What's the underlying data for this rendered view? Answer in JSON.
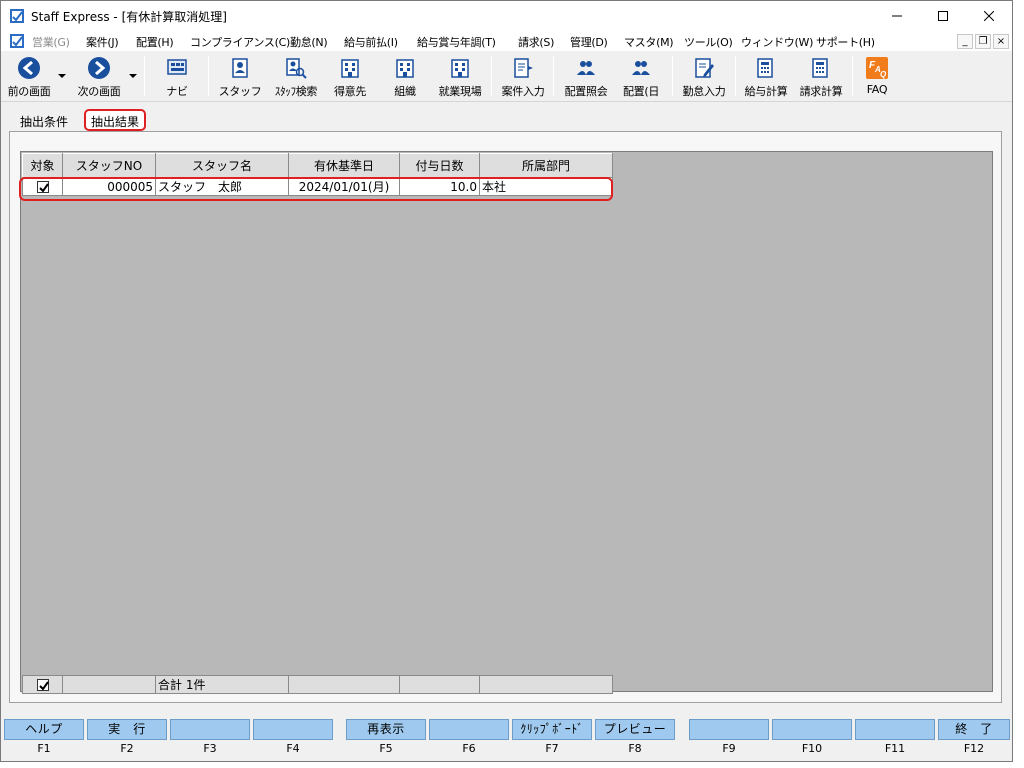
{
  "window": {
    "title": "Staff Express - [有休計算取消処理]"
  },
  "menubar": {
    "items": [
      {
        "label": "営業(G)",
        "disabled": true
      },
      {
        "label": "案件(J)"
      },
      {
        "label": "配置(H)"
      },
      {
        "label": "コンプライアンス(C)"
      },
      {
        "label": "勤怠(N)"
      },
      {
        "label": "給与前払(I)"
      },
      {
        "label": "給与賞与年調(T)"
      },
      {
        "label": "請求(S)"
      },
      {
        "label": "管理(D)"
      },
      {
        "label": "マスタ(M)"
      },
      {
        "label": "ツール(O)"
      },
      {
        "label": "ウィンドウ(W)"
      },
      {
        "label": "サポート(H)"
      }
    ],
    "mdi_minimize": "_",
    "mdi_restore": "❐",
    "mdi_close": "×"
  },
  "toolbar": {
    "items": [
      {
        "label": "前の画面",
        "icon": "back-arrow-icon"
      },
      {
        "label": "次の画面",
        "icon": "forward-arrow-icon"
      },
      {
        "label": "ナビ",
        "icon": "navi-icon"
      },
      {
        "label": "スタッフ",
        "icon": "staff-icon"
      },
      {
        "label": "ｽﾀｯﾌ検索",
        "icon": "staff-search-icon"
      },
      {
        "label": "得意先",
        "icon": "client-icon"
      },
      {
        "label": "組織",
        "icon": "organization-icon"
      },
      {
        "label": "就業現場",
        "icon": "worksite-icon"
      },
      {
        "label": "案件入力",
        "icon": "case-input-icon"
      },
      {
        "label": "配置照会",
        "icon": "assignment-inquiry-icon"
      },
      {
        "label": "配置(日",
        "icon": "assignment-daily-icon"
      },
      {
        "label": "勤怠入力",
        "icon": "attendance-input-icon"
      },
      {
        "label": "給与計算",
        "icon": "payroll-icon"
      },
      {
        "label": "請求計算",
        "icon": "billing-icon"
      },
      {
        "label": "FAQ",
        "icon": "faq-icon"
      }
    ]
  },
  "tabs": [
    {
      "label": "抽出条件",
      "active": false
    },
    {
      "label": "抽出結果",
      "active": true
    }
  ],
  "grid": {
    "columns": [
      "対象",
      "スタッフNO",
      "スタッフ名",
      "有休基準日",
      "付与日数",
      "所属部門"
    ],
    "rows": [
      {
        "checked": true,
        "staff_no": "000005",
        "staff_name": "スタッフ　太郎",
        "base_date": "2024/01/01(月)",
        "days": "10.0",
        "department": "本社"
      }
    ],
    "footer": {
      "checked": true,
      "total": "合計 1件"
    }
  },
  "fkeys": [
    {
      "label": "ヘルプ",
      "key": "F1"
    },
    {
      "label": "実　行",
      "key": "F2"
    },
    {
      "label": "",
      "key": "F3"
    },
    {
      "label": "",
      "key": "F4"
    },
    {
      "label": "再表示",
      "key": "F5"
    },
    {
      "label": "",
      "key": "F6"
    },
    {
      "label": "ｸﾘｯﾌﾟﾎﾞｰﾄﾞ",
      "key": "F7"
    },
    {
      "label": "プレビュー",
      "key": "F8"
    },
    {
      "label": "",
      "key": "F9"
    },
    {
      "label": "",
      "key": "F10"
    },
    {
      "label": "",
      "key": "F11"
    },
    {
      "label": "終　了",
      "key": "F12"
    }
  ],
  "colors": {
    "fkey_bg": "#9fc9ee",
    "highlight": "#e02020",
    "grid_bg": "#b8b8b8"
  }
}
